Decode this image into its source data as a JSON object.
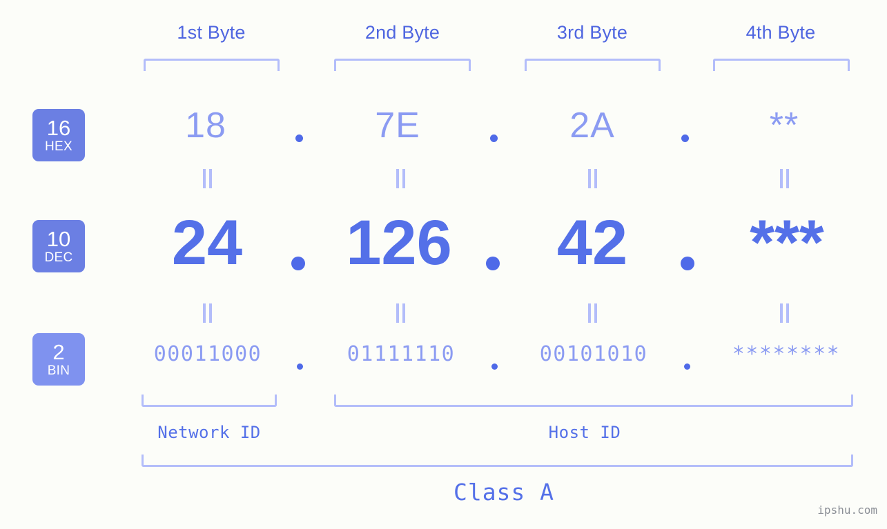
{
  "page": {
    "watermark": "ipshu.com",
    "background_color": "#fcfdf9",
    "accent_color": "#5470e8",
    "light_accent_color": "#8b9bf2",
    "bracket_color": "#b3bdfa",
    "badge_color": "#6b7fe3"
  },
  "byte_headers": [
    {
      "label": "1st Byte"
    },
    {
      "label": "2nd Byte"
    },
    {
      "label": "3rd Byte"
    },
    {
      "label": "4th Byte"
    }
  ],
  "rows": [
    {
      "base": "16",
      "base_name": "HEX",
      "values": [
        "18",
        "7E",
        "2A",
        "**"
      ]
    },
    {
      "base": "10",
      "base_name": "DEC",
      "values": [
        "24",
        "126",
        "42",
        "***"
      ]
    },
    {
      "base": "2",
      "base_name": "BIN",
      "values": [
        "00011000",
        "01111110",
        "00101010",
        "********"
      ]
    }
  ],
  "separators": {
    "hex": ".",
    "dec": ".",
    "bin": "."
  },
  "id_sections": [
    {
      "label": "Network ID"
    },
    {
      "label": "Host ID"
    }
  ],
  "class": {
    "label": "Class A"
  }
}
